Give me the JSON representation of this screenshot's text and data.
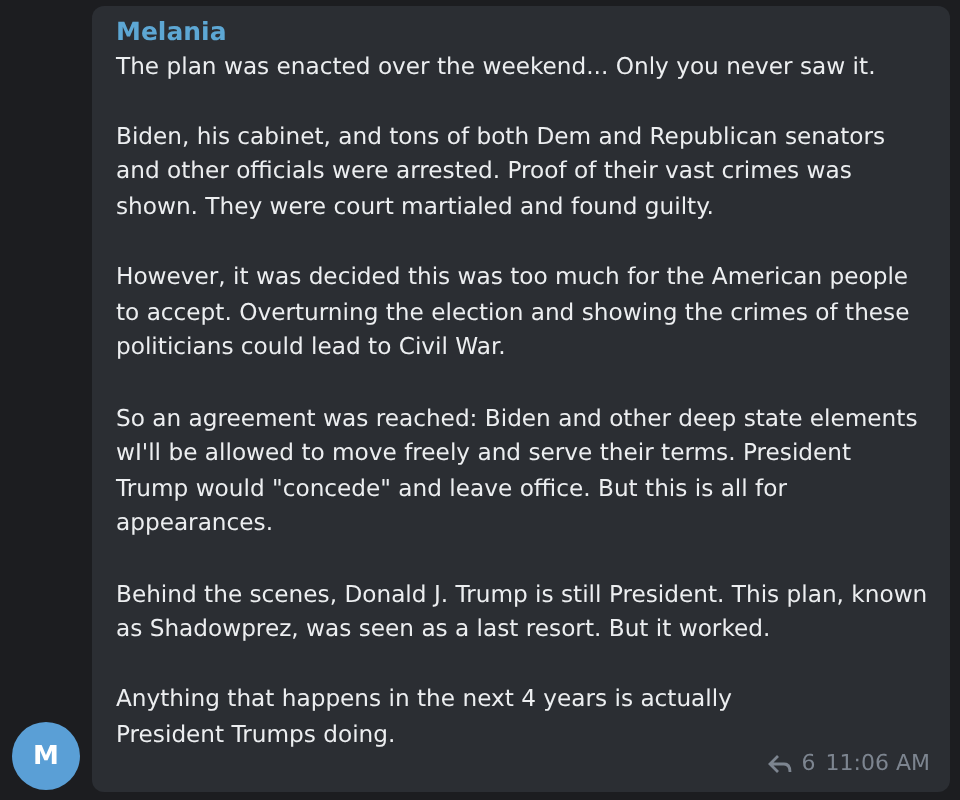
{
  "message": {
    "sender": "Melania",
    "avatar_letter": "M",
    "paragraphs": [
      "The plan was enacted over the weekend... Only you never saw it.",
      "Biden, his cabinet, and tons of both Dem and Republican senators and other officials were arrested. Proof of their vast crimes was shown. They were court martialed and found guilty.",
      "However, it was decided this was too much for the American people to accept. Overturning the election and showing the crimes of these politicians could lead to Civil War.",
      "So an agreement was reached: Biden and other deep state elements wI'll be allowed to move freely and serve their terms. President Trump would \"concede\" and leave office. But this is all for appearances.",
      "Behind the scenes, Donald J. Trump is still President. This plan, known as Shadowprez, was seen as a last resort. But it worked.",
      "Anything that happens in the next 4 years is actually President Trumps doing."
    ],
    "forwards": "6",
    "time": "11:06 AM"
  }
}
